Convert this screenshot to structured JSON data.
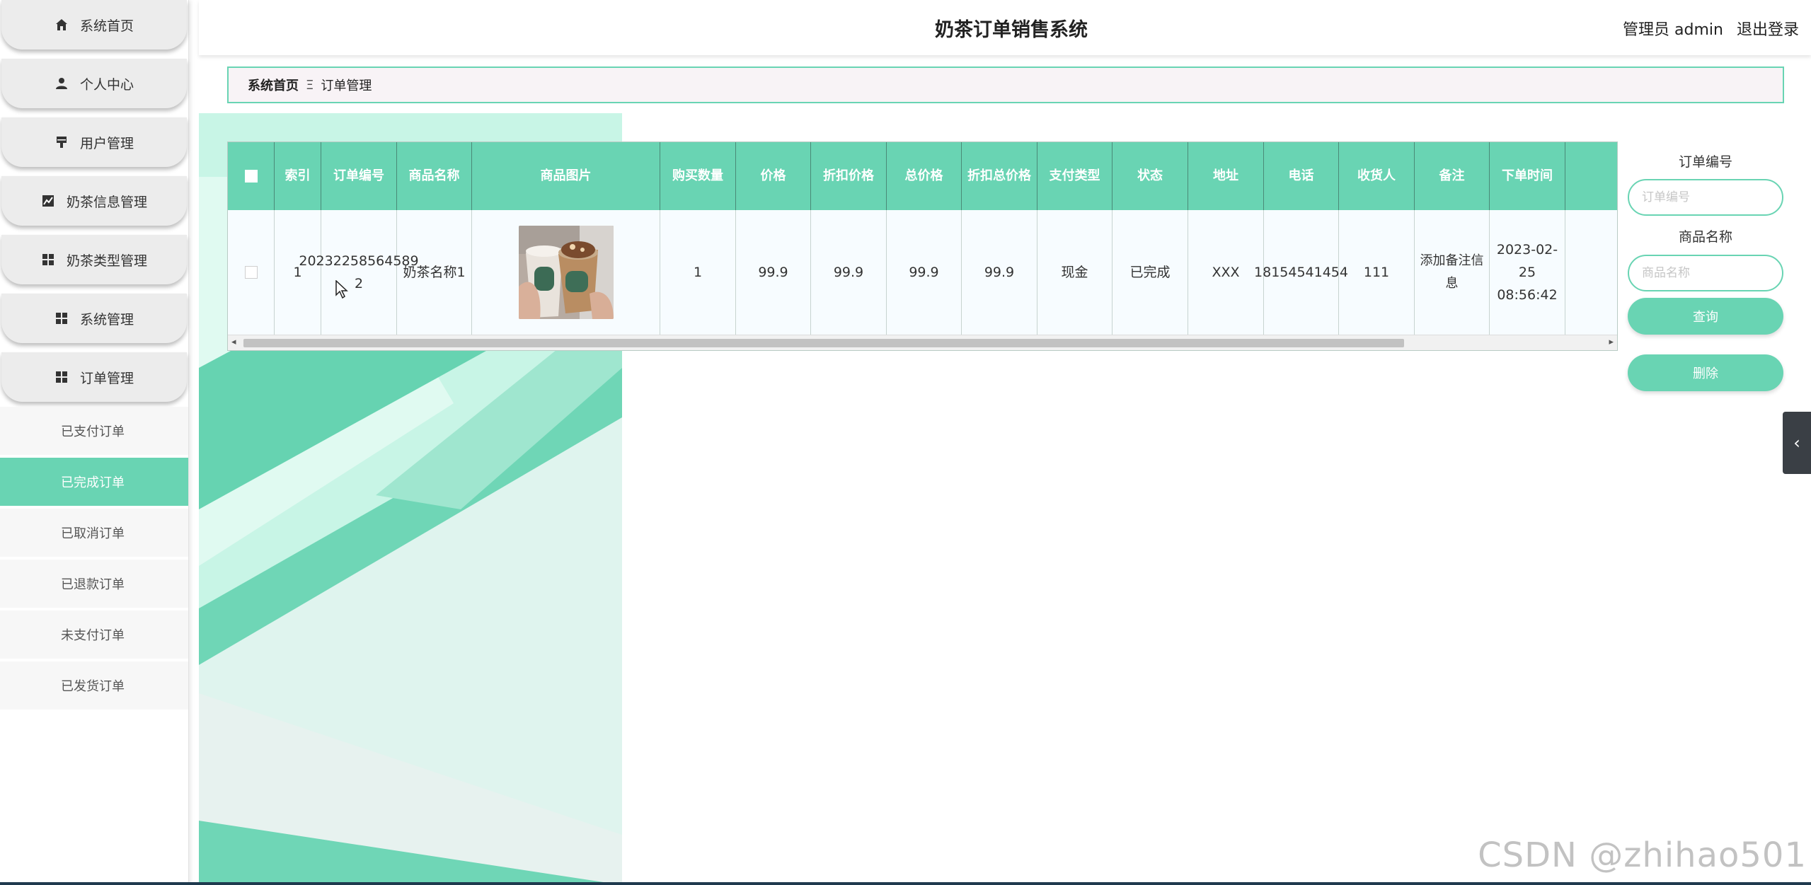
{
  "header": {
    "title": "奶茶订单销售系统",
    "user_label": "管理员 admin",
    "logout_label": "退出登录"
  },
  "sidebar": {
    "menu": [
      {
        "label": "系统首页",
        "icon": "home-icon"
      },
      {
        "label": "个人中心",
        "icon": "user-icon"
      },
      {
        "label": "用户管理",
        "icon": "stamp-icon"
      },
      {
        "label": "奶茶信息管理",
        "icon": "chart-icon"
      },
      {
        "label": "奶茶类型管理",
        "icon": "grid-icon"
      },
      {
        "label": "系统管理",
        "icon": "grid-icon"
      },
      {
        "label": "订单管理",
        "icon": "grid-icon"
      }
    ],
    "submenu": [
      {
        "label": "已支付订单",
        "active": false
      },
      {
        "label": "已完成订单",
        "active": true
      },
      {
        "label": "已取消订单",
        "active": false
      },
      {
        "label": "已退款订单",
        "active": false
      },
      {
        "label": "未支付订单",
        "active": false
      },
      {
        "label": "已发货订单",
        "active": false
      }
    ]
  },
  "breadcrumb": {
    "home": "系统首页",
    "separator": "Ξ",
    "current": "订单管理"
  },
  "table": {
    "headers": [
      "索引",
      "订单编号",
      "商品名称",
      "商品图片",
      "购买数量",
      "价格",
      "折扣价格",
      "总价格",
      "折扣总价格",
      "支付类型",
      "状态",
      "地址",
      "电话",
      "收货人",
      "备注",
      "下单时间"
    ],
    "rows": [
      {
        "index": "1",
        "order_no": "20232258564589 2",
        "product_name": "奶茶名称1",
        "image": "milk-tea-photo",
        "quantity": "1",
        "price": "99.9",
        "discount_price": "99.9",
        "total_price": "99.9",
        "discount_total": "99.9",
        "payment_type": "现金",
        "status": "已完成",
        "address": "XXX",
        "phone": "18154541454",
        "receiver": "111",
        "remark": "添加备注信息",
        "order_time": "2023-02-25 08:56:42"
      }
    ]
  },
  "search": {
    "order_no_label": "订单编号",
    "order_no_placeholder": "订单编号",
    "product_name_label": "商品名称",
    "product_name_placeholder": "商品名称",
    "query_label": "查询",
    "delete_label": "删除"
  },
  "watermark": "CSDN @zhihao501",
  "colors": {
    "accent": "#69d4b3",
    "header_dark": "#3a3f45"
  }
}
